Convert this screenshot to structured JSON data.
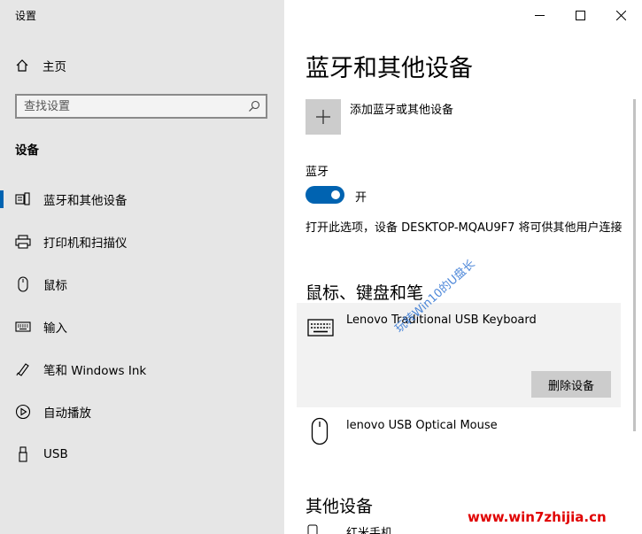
{
  "window": {
    "title": "设置"
  },
  "sidebar": {
    "home_label": "主页",
    "search_placeholder": "查找设置",
    "section_title": "设备",
    "items": [
      {
        "label": "蓝牙和其他设备",
        "icon": "bluetooth-devices-icon",
        "active": true
      },
      {
        "label": "打印机和扫描仪",
        "icon": "printer-icon"
      },
      {
        "label": "鼠标",
        "icon": "mouse-icon"
      },
      {
        "label": "输入",
        "icon": "keyboard-icon"
      },
      {
        "label": "笔和 Windows Ink",
        "icon": "pen-icon"
      },
      {
        "label": "自动播放",
        "icon": "autoplay-icon"
      },
      {
        "label": "USB",
        "icon": "usb-icon"
      }
    ]
  },
  "main": {
    "title": "蓝牙和其他设备",
    "add_device_label": "添加蓝牙或其他设备",
    "bluetooth_label": "蓝牙",
    "bluetooth_state": "开",
    "bluetooth_on": true,
    "discoverable_text": "打开此选项，设备 DESKTOP-MQAU9F7 将可供其他用户连接",
    "section_input": "鼠标、键盘和笔",
    "devices": [
      {
        "name": "Lenovo Traditional USB Keyboard",
        "icon": "keyboard-icon"
      },
      {
        "name": "lenovo USB Optical Mouse",
        "icon": "mouse-icon"
      }
    ],
    "remove_label": "删除设备",
    "section_other": "其他设备",
    "other_devices": [
      {
        "name": "红米手机"
      }
    ]
  },
  "watermark": {
    "text": "玩转Win10的U盘长",
    "url": "www.win7zhijia.cn"
  },
  "colors": {
    "accent": "#0063b1",
    "sidebar_bg": "#e6e6e6",
    "card_bg": "#f2f2f2"
  }
}
